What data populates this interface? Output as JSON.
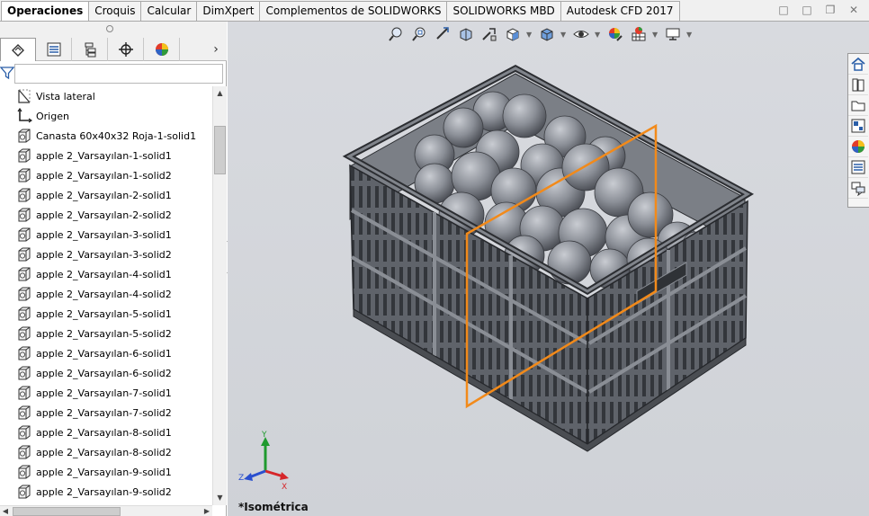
{
  "tabs": [
    {
      "label": "Operaciones",
      "active": true
    },
    {
      "label": "Croquis"
    },
    {
      "label": "Calcular"
    },
    {
      "label": "DimXpert"
    },
    {
      "label": "Complementos de SOLIDWORKS"
    },
    {
      "label": "SOLIDWORKS MBD"
    },
    {
      "label": "Autodesk CFD 2017"
    }
  ],
  "tree": {
    "items": [
      {
        "label": "Vista lateral",
        "icon": "plane-icon"
      },
      {
        "label": "Origen",
        "icon": "origin-icon"
      },
      {
        "label": "Canasta 60x40x32 Roja-1-solid1",
        "icon": "solid-body-icon"
      },
      {
        "label": "apple 2_Varsayılan-1-solid1",
        "icon": "solid-body-icon"
      },
      {
        "label": "apple 2_Varsayılan-1-solid2",
        "icon": "solid-body-icon"
      },
      {
        "label": "apple 2_Varsayılan-2-solid1",
        "icon": "solid-body-icon"
      },
      {
        "label": "apple 2_Varsayılan-2-solid2",
        "icon": "solid-body-icon"
      },
      {
        "label": "apple 2_Varsayılan-3-solid1",
        "icon": "solid-body-icon"
      },
      {
        "label": "apple 2_Varsayılan-3-solid2",
        "icon": "solid-body-icon"
      },
      {
        "label": "apple 2_Varsayılan-4-solid1",
        "icon": "solid-body-icon"
      },
      {
        "label": "apple 2_Varsayılan-4-solid2",
        "icon": "solid-body-icon"
      },
      {
        "label": "apple 2_Varsayılan-5-solid1",
        "icon": "solid-body-icon"
      },
      {
        "label": "apple 2_Varsayılan-5-solid2",
        "icon": "solid-body-icon"
      },
      {
        "label": "apple 2_Varsayılan-6-solid1",
        "icon": "solid-body-icon"
      },
      {
        "label": "apple 2_Varsayılan-6-solid2",
        "icon": "solid-body-icon"
      },
      {
        "label": "apple 2_Varsayılan-7-solid1",
        "icon": "solid-body-icon"
      },
      {
        "label": "apple 2_Varsayılan-7-solid2",
        "icon": "solid-body-icon"
      },
      {
        "label": "apple 2_Varsayılan-8-solid1",
        "icon": "solid-body-icon"
      },
      {
        "label": "apple 2_Varsayılan-8-solid2",
        "icon": "solid-body-icon"
      },
      {
        "label": "apple 2_Varsayılan-9-solid1",
        "icon": "solid-body-icon"
      },
      {
        "label": "apple 2_Varsayılan-9-solid2",
        "icon": "solid-body-icon"
      }
    ]
  },
  "viewport": {
    "view_label": "*Isométrica",
    "plane_color": "#f28a1a",
    "model_color": "#6c7077",
    "axes": {
      "x": "X",
      "y": "Y",
      "z": "Z"
    }
  },
  "colors": {
    "accent": "#f28a1a",
    "background": "#d5d7dc"
  }
}
